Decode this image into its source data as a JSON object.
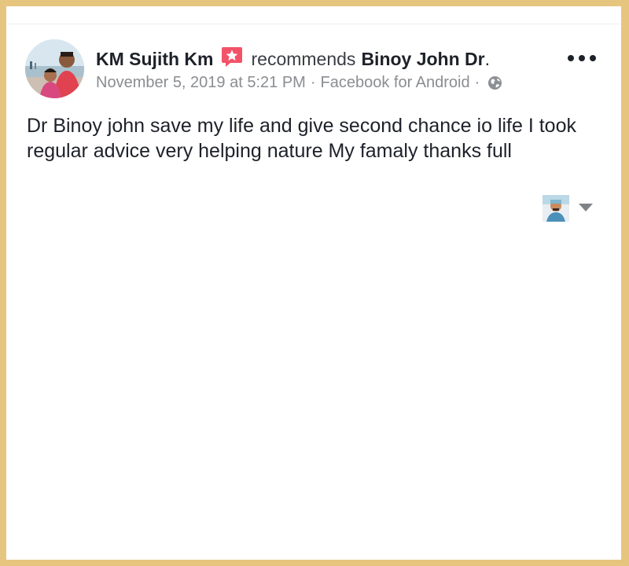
{
  "post": {
    "author": "KM Sujith Km",
    "recommends_text": "recommends",
    "page_name": "Binoy John Dr",
    "period": ".",
    "date": "November 5, 2019 at 5:21 PM",
    "separator_1": "·",
    "source": "Facebook for Android",
    "separator_2": "·",
    "privacy_icon": "globe-icon",
    "badge_icon": "recommendation-star-icon",
    "body": "Dr Binoy john save my life and give second chance io life I took regular advice very helping nature My famaly thanks full"
  },
  "colors": {
    "frame": "#e6c57e",
    "badge": "#f35369",
    "text": "#1d2129",
    "meta": "#8a8d91"
  }
}
